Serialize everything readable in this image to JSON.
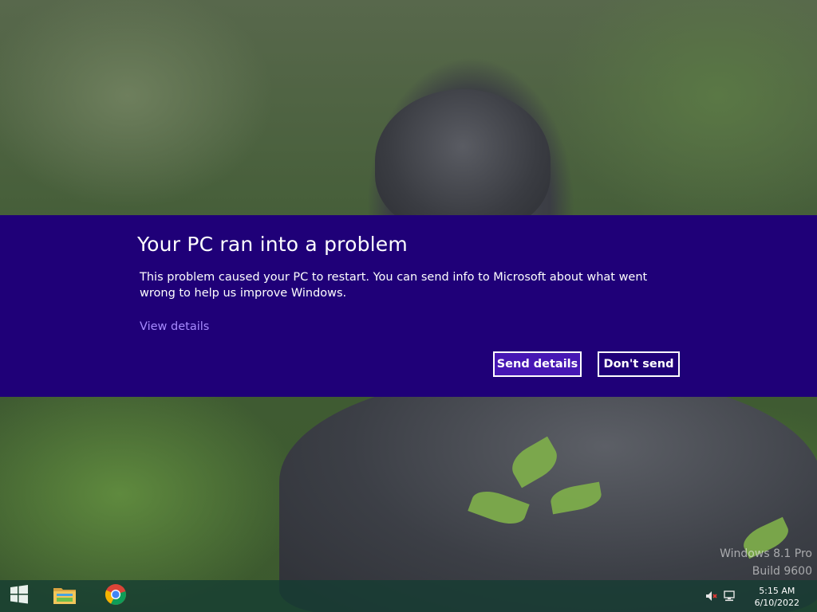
{
  "error": {
    "title": "Your PC ran into a problem",
    "message": "This problem caused your PC to restart. You can send info to Microsoft about what went wrong to help us improve Windows.",
    "view_details": "View details",
    "send_label": "Send details",
    "dont_send_label": "Don't send"
  },
  "watermark": {
    "line1": "Windows 8.1 Pro",
    "line2": "Build 9600"
  },
  "taskbar": {
    "pinned": [
      "start-icon",
      "file-explorer-icon",
      "chrome-icon"
    ],
    "tray": {
      "volume_icon": "volume-muted-icon",
      "network_icon": "network-icon",
      "time": "5:15 AM",
      "date": "6/10/2022"
    }
  },
  "colors": {
    "banner": "#1f0078",
    "primary_button": "#4617b4",
    "link": "#a78bff"
  }
}
